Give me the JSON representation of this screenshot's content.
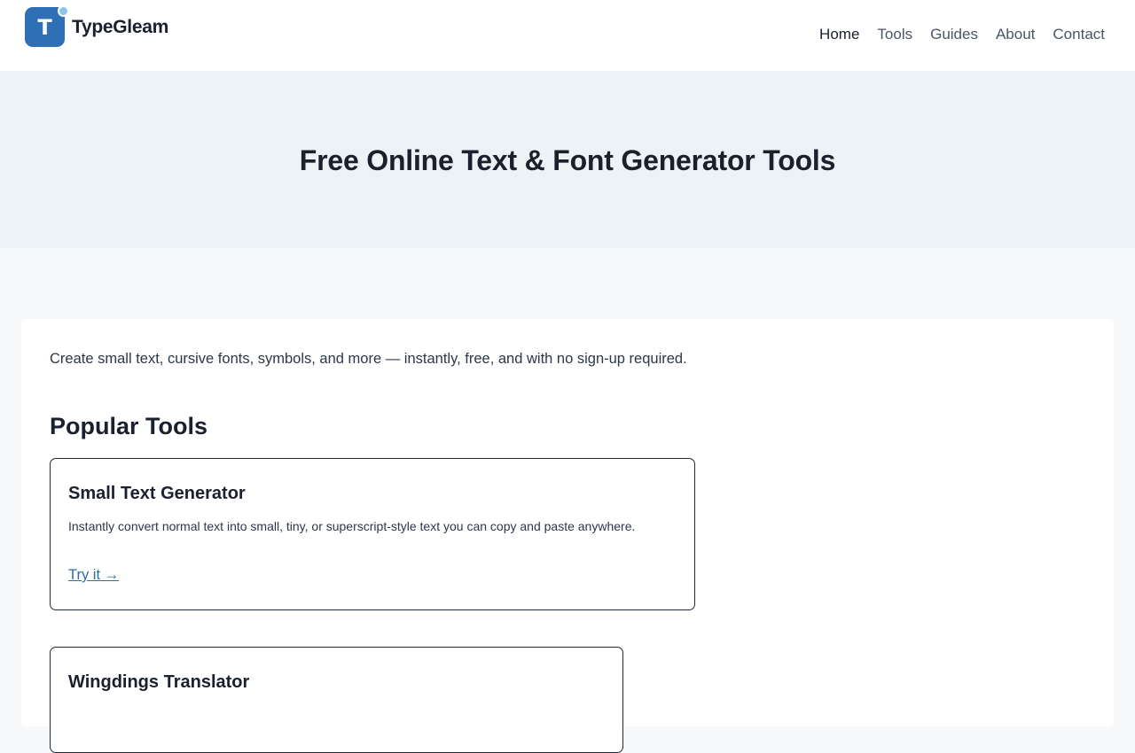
{
  "header": {
    "brand": "TypeGleam",
    "logo_letter": "T",
    "nav": [
      "Home",
      "Tools",
      "Guides",
      "About",
      "Contact"
    ],
    "active_nav": "Home"
  },
  "hero": {
    "title": "Free Online Text & Font Generator Tools"
  },
  "main": {
    "intro": "Create small text, cursive fonts, symbols, and more — instantly, free, and with no sign-up required.",
    "section_title": "Popular Tools",
    "tools": [
      {
        "title": "Small Text Generator",
        "description": "Instantly convert normal text into small, tiny, or superscript-style text you can copy and paste anywhere.",
        "link": "Try it →"
      },
      {
        "title": "Wingdings Translator"
      }
    ]
  },
  "colors": {
    "accent": "#2f6fb5",
    "link": "#2b6cb0",
    "hero_bg": "#edf2f7"
  }
}
